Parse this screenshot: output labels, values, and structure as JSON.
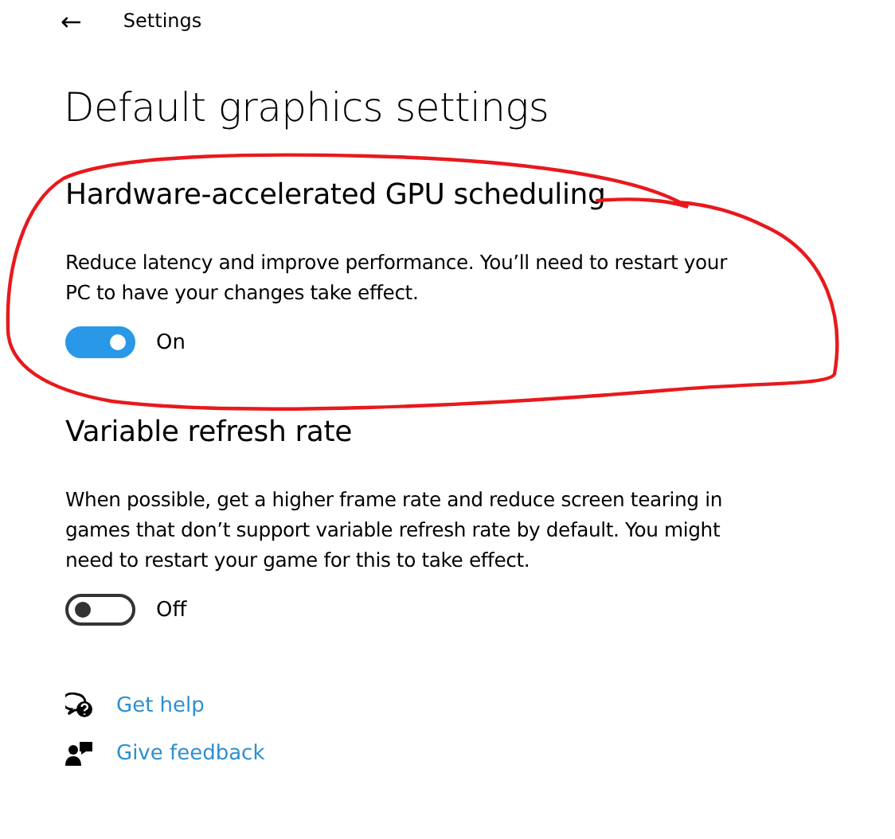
{
  "header": {
    "back": "←",
    "title": "Settings"
  },
  "page_title": "Default graphics settings",
  "sections": [
    {
      "heading": "Hardware-accelerated GPU scheduling",
      "description": "Reduce latency and improve performance. You’ll need to restart your PC to have your changes take effect.",
      "toggle": {
        "on": true,
        "label": "On"
      }
    },
    {
      "heading": "Variable refresh rate",
      "description": "When possible, get a higher frame rate and reduce screen tearing in games that don’t support variable refresh rate by default. You might need to restart your game for this to take effect.",
      "toggle": {
        "on": false,
        "label": "Off"
      }
    }
  ],
  "links": [
    {
      "kind": "help",
      "label": "Get help"
    },
    {
      "kind": "feedback",
      "label": "Give feedback"
    }
  ]
}
